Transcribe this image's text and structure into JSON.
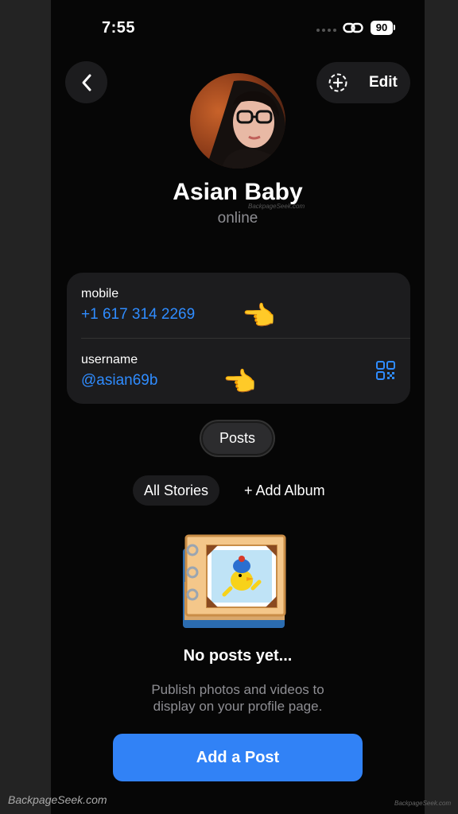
{
  "status_bar": {
    "time": "7:55",
    "battery": "90"
  },
  "header": {
    "edit_label": "Edit"
  },
  "profile": {
    "name": "Asian Baby",
    "status": "online"
  },
  "info": {
    "mobile_label": "mobile",
    "mobile_value": "+1 617 314 2269",
    "username_label": "username",
    "username_value": "@asian69b",
    "pointer_emoji": "👈"
  },
  "tabs": {
    "posts": "Posts"
  },
  "stories": {
    "all": "All Stories",
    "add_album": "+ Add Album"
  },
  "empty_state": {
    "title": "No posts yet...",
    "line1": "Publish photos and videos to",
    "line2": "display on your profile page.",
    "button": "Add a Post"
  },
  "watermarks": {
    "left": "BackpageSeek.com",
    "small": "BackpageSeek.com",
    "right": "BackpageSeek.com"
  },
  "colors": {
    "accent": "#3182f6",
    "link": "#2f8cff",
    "card": "#1c1c1e",
    "background": "#060606"
  }
}
